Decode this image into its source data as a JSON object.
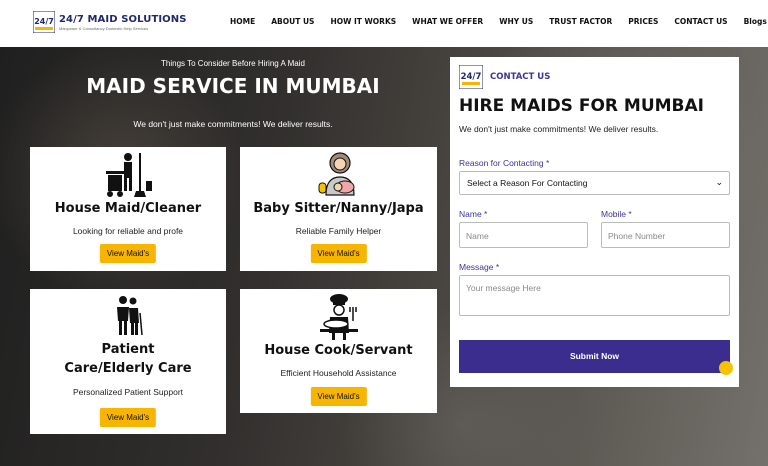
{
  "logo": {
    "title": "24/7 MAID SOLUTIONS",
    "subtitle": "Manpower & Consultancy Domestic Help Services",
    "badge_text": "24/7"
  },
  "nav": [
    "HOME",
    "ABOUT US",
    "HOW IT WORKS",
    "WHAT WE OFFER",
    "WHY US",
    "TRUST FACTOR",
    "PRICES",
    "CONTACT US",
    "Blogs"
  ],
  "hero": {
    "eyebrow": "Things To Consider Before Hiring A Maid",
    "title": "MAID SERVICE IN MUMBAI",
    "tagline": "We don't just make commitments! We deliver results."
  },
  "cards": [
    {
      "title": "House Maid/Cleaner",
      "desc": "Looking for reliable and profe",
      "button": "View Maid's",
      "icon": "cleaner-icon"
    },
    {
      "title": "Baby Sitter/Nanny/Japa",
      "desc": "Reliable Family Helper",
      "button": "View Maid's",
      "icon": "nanny-icon"
    },
    {
      "title_line1": "Patient",
      "title_line2": "Care/Elderly Care",
      "desc": "Personalized Patient Support",
      "button": "View Maid's",
      "icon": "elderly-care-icon"
    },
    {
      "title": "House Cook/Servant",
      "desc": "Efficient Household Assistance",
      "button": "View Maid's",
      "icon": "chef-icon"
    }
  ],
  "form": {
    "contact_label": "CONTACT US",
    "title": "HIRE MAIDS FOR MUMBAI",
    "subtitle": "We don't just make commitments! We deliver results.",
    "reason_label": "Reason for Contacting *",
    "reason_value": "Select a Reason For Contacting",
    "name_label": "Name *",
    "name_placeholder": "Name",
    "mobile_label": "Mobile *",
    "mobile_placeholder": "Phone Number",
    "message_label": "Message *",
    "message_placeholder": "Your message Here",
    "submit": "Submit Now"
  },
  "colors": {
    "accent_yellow": "#f7b500",
    "brand_purple": "#3b2d8e",
    "label_purple": "#3d3398"
  }
}
